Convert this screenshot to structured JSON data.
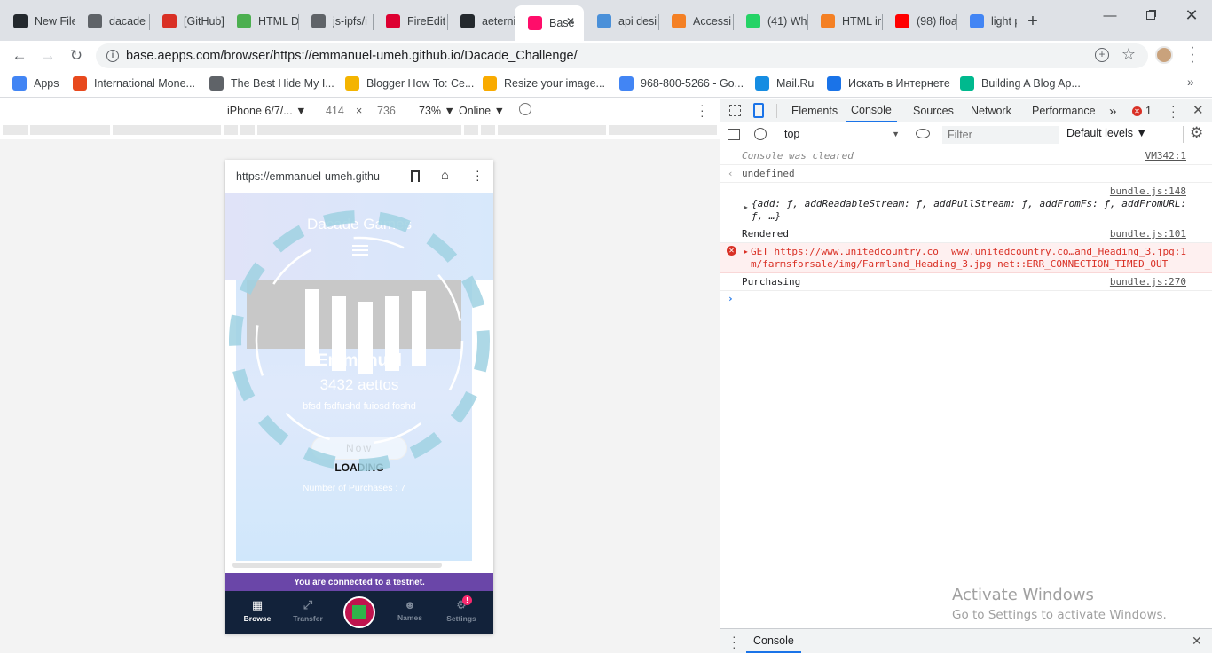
{
  "tabs": [
    {
      "title": "New File",
      "icon": "github-icon",
      "color": "#24292e"
    },
    {
      "title": "dacade",
      "icon": "folder-icon",
      "color": "#5f6368"
    },
    {
      "title": "[GitHub]",
      "icon": "gmail-icon",
      "color": "#d93025"
    },
    {
      "title": "HTML D",
      "icon": "w3-icon",
      "color": "#4caf50"
    },
    {
      "title": "js-ipfs/i",
      "icon": "folder-icon",
      "color": "#5f6368"
    },
    {
      "title": "FireEdit",
      "icon": "angular-icon",
      "color": "#dd0031"
    },
    {
      "title": "aeternit",
      "icon": "github-icon",
      "color": "#24292e"
    },
    {
      "title": "Base",
      "icon": "aeternity-icon",
      "color": "#ff0d6a"
    },
    {
      "title": "api desi",
      "icon": "eth-icon",
      "color": "#4a90d9"
    },
    {
      "title": "Accessi",
      "icon": "stackoverflow-icon",
      "color": "#f48024"
    },
    {
      "title": "(41) Wh",
      "icon": "whatsapp-icon",
      "color": "#25d366"
    },
    {
      "title": "HTML ir",
      "icon": "stackoverflow-icon",
      "color": "#f48024"
    },
    {
      "title": "(98) floa",
      "icon": "youtube-icon",
      "color": "#ff0000"
    },
    {
      "title": "light pa",
      "icon": "google-icon",
      "color": "#4285f4"
    }
  ],
  "url": "base.aepps.com/browser/https://emmanuel-umeh.github.io/Dacade_Challenge/",
  "bookmarks": [
    {
      "label": "Apps",
      "icon": "apps-grid-icon",
      "color": "#4285f4"
    },
    {
      "label": "International Mone...",
      "icon": "bookmark-favicon-icon",
      "color": "#e8491d"
    },
    {
      "label": "The Best Hide My I...",
      "icon": "globe-icon",
      "color": "#5f6368"
    },
    {
      "label": "Blogger How To: Ce...",
      "icon": "info-icon",
      "color": "#f4b400"
    },
    {
      "label": "Resize your image...",
      "icon": "resize-icon",
      "color": "#f9ab00"
    },
    {
      "label": "968-800-5266 - Go...",
      "icon": "google-icon",
      "color": "#4285f4"
    },
    {
      "label": "Mail.Ru",
      "icon": "mailru-icon",
      "color": "#168de2"
    },
    {
      "label": "Искать в Интернете",
      "icon": "search-icon",
      "color": "#1a73e8"
    },
    {
      "label": "Building A Blog Ap...",
      "icon": "feather-icon",
      "color": "#00b98e"
    }
  ],
  "device": {
    "name": "iPhone 6/7/...",
    "width": "414",
    "times": "×",
    "height": "736",
    "zoom": "73%",
    "network": "Online"
  },
  "phone": {
    "url": "https://emmanuel-umeh.githu",
    "title": "Dacade Games",
    "user": "Emmanuel",
    "balance": "3432 aettos",
    "desc": "bfsd fsdfushd fuiosd foshd",
    "buy": "Now",
    "loading": "LOADING",
    "purchases": "Number of Purchases : 7",
    "testnet": "You are connected to a testnet.",
    "nav": [
      {
        "label": "Browse",
        "icon": "grid-icon"
      },
      {
        "label": "Transfer",
        "icon": "transfer-icon"
      },
      {
        "label": "Names",
        "icon": "person-icon"
      },
      {
        "label": "Settings",
        "icon": "settings-icon"
      }
    ],
    "settings_badge": "!"
  },
  "devtools": {
    "tabs": [
      "Elements",
      "Console",
      "Sources",
      "Network",
      "Performance"
    ],
    "more": "»",
    "error_count": "1",
    "context": "top",
    "filter_placeholder": "Filter",
    "levels": "Default levels",
    "messages": [
      {
        "text": "Console was cleared",
        "source": "VM342:1",
        "type": "info"
      },
      {
        "text": "undefined",
        "source": "",
        "type": "result"
      },
      {
        "text": "{add: ƒ, addReadableStream: ƒ, addPullStream: ƒ, addFromFs: ƒ, addFromURL:\nƒ, …}",
        "source": "bundle.js:148",
        "type": "object"
      },
      {
        "text": "Rendered",
        "source": "bundle.js:101",
        "type": "log"
      },
      {
        "text": "GET https://www.unitedcountry.co\nm/farmsforsale/img/Farmland_Heading_3.jpg net::ERR_CONNECTION_TIMED_OUT",
        "source": "www.unitedcountry.co…and_Heading_3.jpg:1",
        "type": "error"
      },
      {
        "text": "Purchasing",
        "source": "bundle.js:270",
        "type": "log"
      }
    ],
    "drawer_tab": "Console"
  },
  "watermark": {
    "line1": "Activate Windows",
    "line2": "Go to Settings to activate Windows."
  }
}
